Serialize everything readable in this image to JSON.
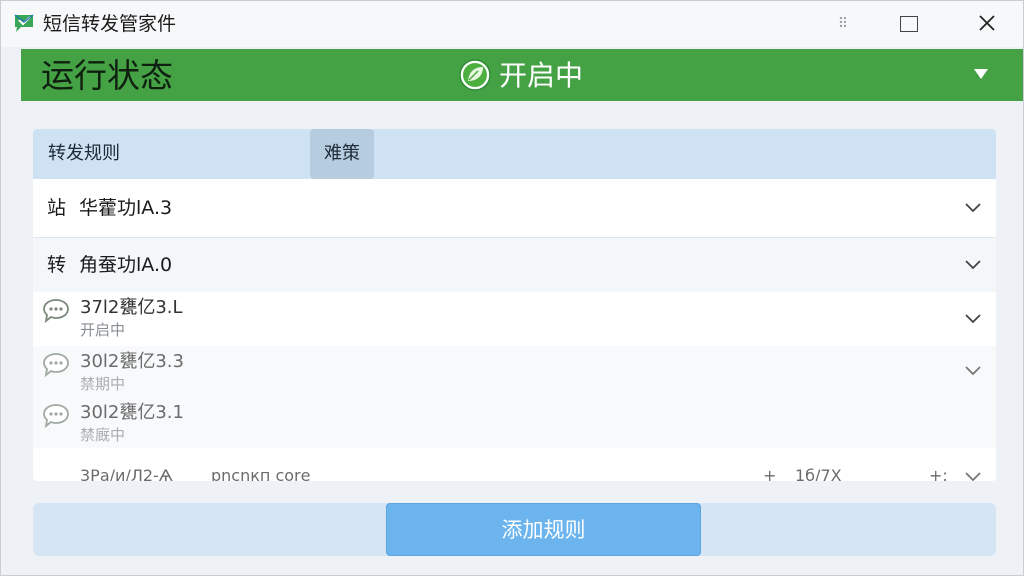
{
  "window": {
    "title": "短信转发管家件",
    "grip_glyph": "⠿"
  },
  "status": {
    "label": "运行状态",
    "value": "开启中",
    "banner_color": "#44a244"
  },
  "rules": {
    "header_title": "转发规则",
    "header_tab": "难策",
    "rows": [
      {
        "prefix": "站",
        "name": "华藿功lA.3"
      },
      {
        "prefix": "转",
        "name": "角蚕功lA.0"
      },
      {
        "title": "37l2甕亿3.L",
        "status": "开启中",
        "icon": "chat-bubble-icon"
      },
      {
        "title": "30l2甕亿3.3",
        "status": "禁期中",
        "icon": "chat-bubble-icon"
      },
      {
        "title": "30l2甕亿3.1",
        "status": "禁廐中",
        "icon": "chat-bubble-icon"
      },
      {
        "col1": "3Ра/и/Л2-Ѧ",
        "col2": "pnсnкп соrе",
        "col3": "+",
        "col4": "1б/7Х",
        "col5": "+:"
      }
    ]
  },
  "footer": {
    "add_label": "添加规则",
    "accent_color": "#6cb4ee"
  }
}
